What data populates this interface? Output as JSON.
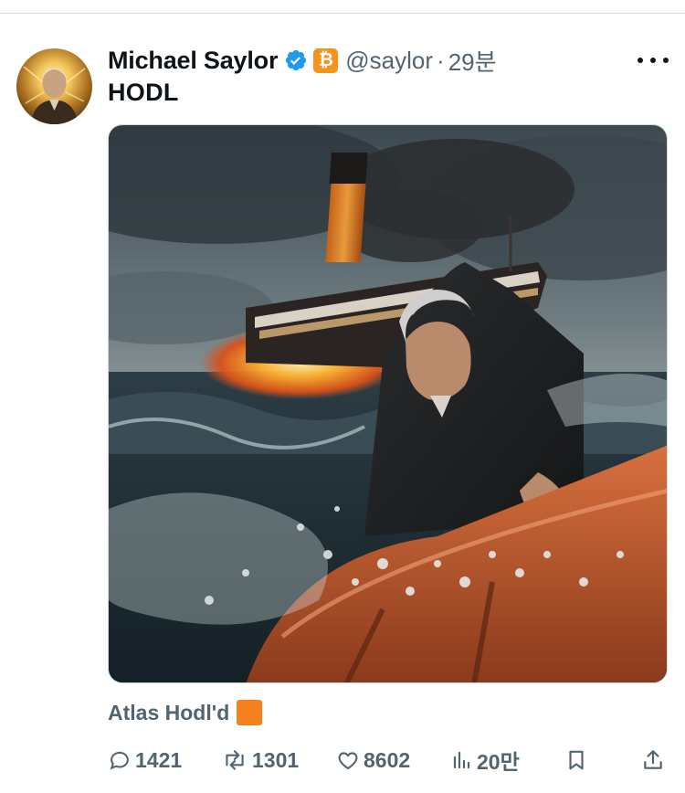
{
  "post": {
    "author_name": "Michael Saylor",
    "handle": "@saylor",
    "separator": "·",
    "time": "29분",
    "text": "HODL",
    "badge_glyph": "₿",
    "media_caption": "Atlas Hodl'd",
    "colors": {
      "verified": "#1d9bf0",
      "badge": "#f7931a",
      "caption_square": "#f5821f",
      "muted": "#536471"
    }
  },
  "actions": {
    "replies": "1421",
    "reposts": "1301",
    "likes": "8602",
    "views": "20만"
  },
  "icons": [
    "verified-icon",
    "bitcoin-badge-icon",
    "more-icon",
    "reply-icon",
    "repost-icon",
    "like-icon",
    "views-icon",
    "bookmark-icon",
    "share-icon"
  ]
}
